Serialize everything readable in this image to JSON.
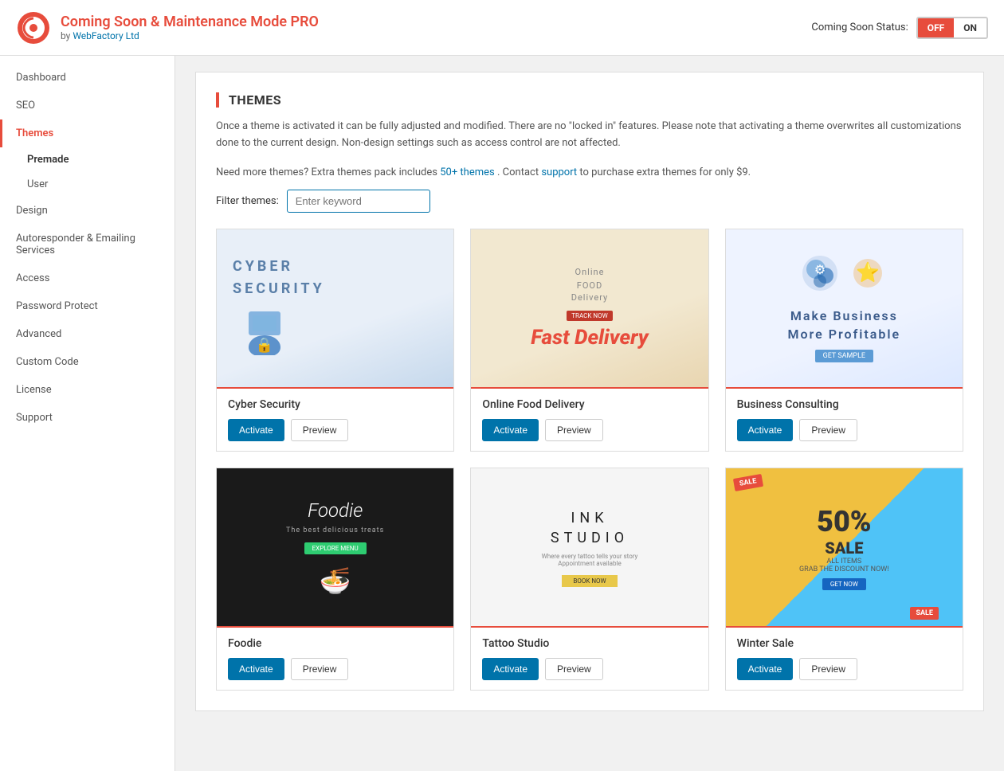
{
  "header": {
    "title": "Coming Soon & Maintenance Mode",
    "title_pro": "PRO",
    "subtitle": "by ",
    "subtitle_link": "WebFactory Ltd",
    "subtitle_url": "#",
    "status_label": "Coming Soon Status:",
    "toggle_off": "OFF",
    "toggle_on": "ON"
  },
  "sidebar": {
    "items": [
      {
        "id": "dashboard",
        "label": "Dashboard",
        "active": false
      },
      {
        "id": "seo",
        "label": "SEO",
        "active": false
      },
      {
        "id": "themes",
        "label": "Themes",
        "active": true
      },
      {
        "id": "premade",
        "label": "Premade",
        "active": true,
        "sub": true
      },
      {
        "id": "user",
        "label": "User",
        "active": false,
        "sub": true
      },
      {
        "id": "design",
        "label": "Design",
        "active": false
      },
      {
        "id": "autoresponder",
        "label": "Autoresponder & Emailing Services",
        "active": false
      },
      {
        "id": "access",
        "label": "Access",
        "active": false
      },
      {
        "id": "password-protect",
        "label": "Password Protect",
        "active": false
      },
      {
        "id": "advanced",
        "label": "Advanced",
        "active": false
      },
      {
        "id": "custom-code",
        "label": "Custom Code",
        "active": false
      },
      {
        "id": "license",
        "label": "License",
        "active": false
      },
      {
        "id": "support",
        "label": "Support",
        "active": false
      }
    ]
  },
  "main": {
    "title": "THEMES",
    "description": "Once a theme is activated it can be fully adjusted and modified. There are no \"locked in\" features. Please note that activating a theme overwrites all customizations done to the current design. Non-design settings such as access control are not affected.",
    "extra_text_before": "Need more themes? Extra themes pack includes ",
    "extra_link1": "50+ themes",
    "extra_link1_url": "#",
    "extra_text_between": ". Contact ",
    "extra_link2": "support",
    "extra_link2_url": "#",
    "extra_text_after": " to purchase extra themes for only $9.",
    "filter_label": "Filter themes:",
    "filter_placeholder": "Enter keyword",
    "themes": [
      {
        "id": "cyber-security",
        "name": "Cyber Security",
        "activate_label": "Activate",
        "preview_label": "Preview",
        "type": "cyber"
      },
      {
        "id": "online-food-delivery",
        "name": "Online Food Delivery",
        "activate_label": "Activate",
        "preview_label": "Preview",
        "type": "food"
      },
      {
        "id": "business-consulting",
        "name": "Business Consulting",
        "activate_label": "Activate",
        "preview_label": "Preview",
        "type": "business"
      },
      {
        "id": "foodie",
        "name": "Foodie",
        "activate_label": "Activate",
        "preview_label": "Preview",
        "type": "foodie"
      },
      {
        "id": "tattoo-studio",
        "name": "Tattoo Studio",
        "activate_label": "Activate",
        "preview_label": "Preview",
        "type": "tattoo"
      },
      {
        "id": "winter-sale",
        "name": "Winter Sale",
        "activate_label": "Activate",
        "preview_label": "Preview",
        "type": "sale"
      }
    ]
  }
}
